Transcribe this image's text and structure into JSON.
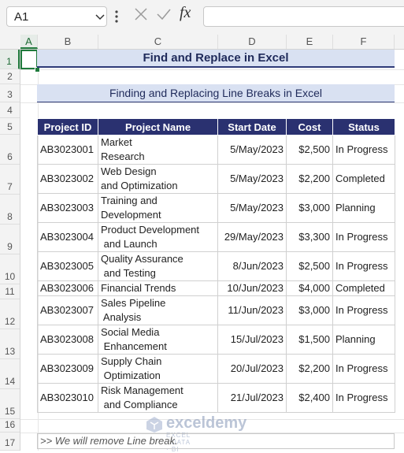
{
  "formula_bar": {
    "name_box": "A1",
    "fx_label": "fx",
    "formula_value": ""
  },
  "columns": [
    "A",
    "B",
    "C",
    "D",
    "E",
    "F"
  ],
  "rows": [
    "1",
    "2",
    "3",
    "4",
    "5",
    "6",
    "7",
    "8",
    "9",
    "10",
    "11",
    "12",
    "13",
    "14",
    "15",
    "16",
    "17"
  ],
  "sheet": {
    "title": "Find and Replace in Excel",
    "subtitle": "Finding and Replacing Line Breaks in Excel",
    "table": {
      "headers": [
        "Project ID",
        "Project Name",
        "Start Date",
        "Cost",
        "Status"
      ],
      "rows": [
        {
          "id": "AB3023001",
          "name": "Market\nResearch",
          "start": "5/May/2023",
          "cost": "$2,500",
          "status": "In Progress"
        },
        {
          "id": "AB3023002",
          "name": "Web Design\nand Optimization",
          "start": "5/May/2023",
          "cost": "$2,200",
          "status": "Completed"
        },
        {
          "id": "AB3023003",
          "name": "Training and\nDevelopment",
          "start": "5/May/2023",
          "cost": "$3,000",
          "status": "Planning"
        },
        {
          "id": "AB3023004",
          "name": "Product Development\n and Launch",
          "start": "29/May/2023",
          "cost": "$3,300",
          "status": "In Progress"
        },
        {
          "id": "AB3023005",
          "name": "Quality Assurance\n and Testing",
          "start": "8/Jun/2023",
          "cost": "$2,500",
          "status": "In Progress"
        },
        {
          "id": "AB3023006",
          "name": "Financial Trends",
          "start": "10/Jun/2023",
          "cost": "$4,000",
          "status": "Completed"
        },
        {
          "id": "AB3023007",
          "name": "Sales Pipeline\n Analysis",
          "start": "11/Jun/2023",
          "cost": "$3,000",
          "status": "In Progress"
        },
        {
          "id": "AB3023008",
          "name": "Social Media\n Enhancement",
          "start": "15/Jul/2023",
          "cost": "$1,500",
          "status": "Planning"
        },
        {
          "id": "AB3023009",
          "name": "Supply Chain\n Optimization",
          "start": "20/Jul/2023",
          "cost": "$2,200",
          "status": "In Progress"
        },
        {
          "id": "AB3023010",
          "name": "Risk Management\n and Compliance",
          "start": "21/Jul/2023",
          "cost": "$2,400",
          "status": "In Progress"
        }
      ]
    },
    "note": ">> We will remove Line break."
  },
  "watermark": {
    "brand": "exceldemy",
    "tagline": "EXCEL · DATA · BI"
  }
}
